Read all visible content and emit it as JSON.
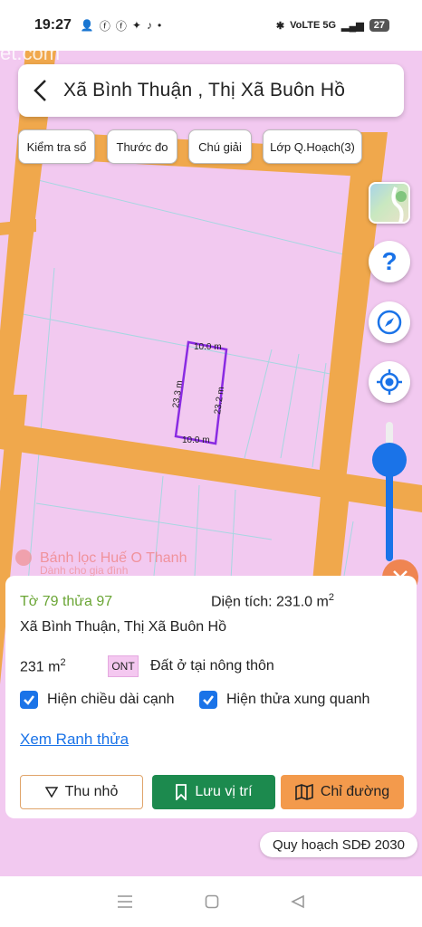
{
  "status_bar": {
    "time": "19:27",
    "network": "VoLTE 5G",
    "battery": "27"
  },
  "header": {
    "title": "Xã Bình Thuận , Thị Xã Buôn Hồ"
  },
  "chips": {
    "check_book": "Kiểm tra sổ",
    "measure": "Thước đo",
    "legend": "Chú giải",
    "layers": "Lớp Q.Hoạch(3)"
  },
  "map": {
    "watermark_top": "et.com",
    "shop_name": "Bánh lọc Huế O Thanh",
    "shop_sub": "Dành cho gia đình",
    "dim_top": "10.0 m",
    "dim_bottom": "10.0 m",
    "dim_left": "23.3 m",
    "dim_right": "23.2 m",
    "plot_color": "#8a2be2"
  },
  "panel": {
    "parcel_id": "Tờ 79 thửa 97",
    "area_text": "Diện tích: 231.0 m",
    "area_unit_sup": "2",
    "address": "Xã Bình Thuận, Thị Xã Buôn Hồ",
    "area_short": "231 m",
    "area_short_sup": "2",
    "land_code": "ONT",
    "land_type": "Đất ở tại nông thôn",
    "check_show_edges": "Hiện chiều dài cạnh",
    "check_show_neighbors": "Hiện thửa xung quanh",
    "link_boundary": "Xem Ranh thửa",
    "btn_collapse": "Thu nhỏ",
    "btn_save": "Lưu vị trí",
    "btn_directions": "Chỉ đường"
  },
  "plan_badge": "Quy hoạch SDĐ 2030",
  "colors": {
    "accent": "#1a73e8",
    "green": "#1c8a4e",
    "orange": "#f39a4c",
    "road": "#f0a84c",
    "land": "#f2c9f0"
  }
}
